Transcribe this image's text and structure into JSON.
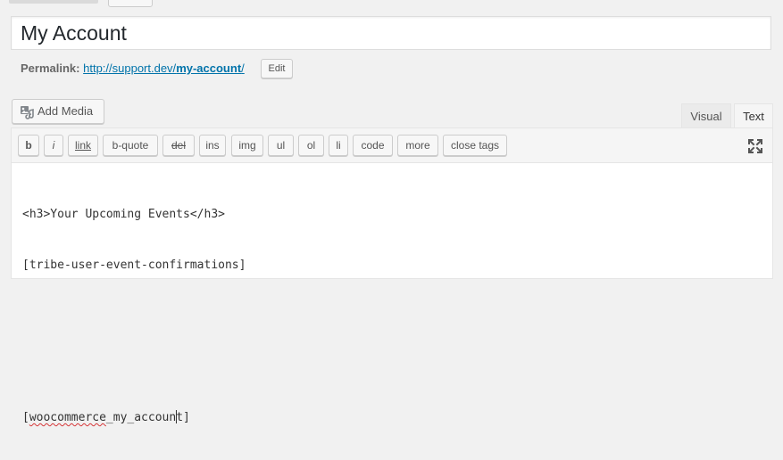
{
  "post": {
    "title": "My Account"
  },
  "permalink": {
    "label": "Permalink:",
    "url_prefix": "http://support.dev/",
    "url_slug": "my-account",
    "url_suffix": "/",
    "edit_label": "Edit"
  },
  "media": {
    "add_media_label": "Add Media",
    "icon": "media-icon"
  },
  "editor_tabs": {
    "visual": "Visual",
    "text": "Text",
    "active": "Text"
  },
  "quicktags": [
    {
      "label": "b"
    },
    {
      "label": "i"
    },
    {
      "label": "link"
    },
    {
      "label": "b-quote"
    },
    {
      "label": "del"
    },
    {
      "label": "ins"
    },
    {
      "label": "img"
    },
    {
      "label": "ul"
    },
    {
      "label": "ol"
    },
    {
      "label": "li"
    },
    {
      "label": "code"
    },
    {
      "label": "more"
    },
    {
      "label": "close tags"
    }
  ],
  "fullscreen_icon": "expand-icon",
  "content": {
    "line1": "<h3>Your Upcoming Events</h3>",
    "line2": "[tribe-user-event-confirmations]",
    "line3": "",
    "line4": "",
    "line5_open": "[",
    "line5_word_a": "woocommerce",
    "line5_mid": "_my_accoun",
    "line5_end": "t]"
  },
  "colors": {
    "link": "#0073aa",
    "spellcheck": "#d63638",
    "background": "#f1f1f1"
  }
}
